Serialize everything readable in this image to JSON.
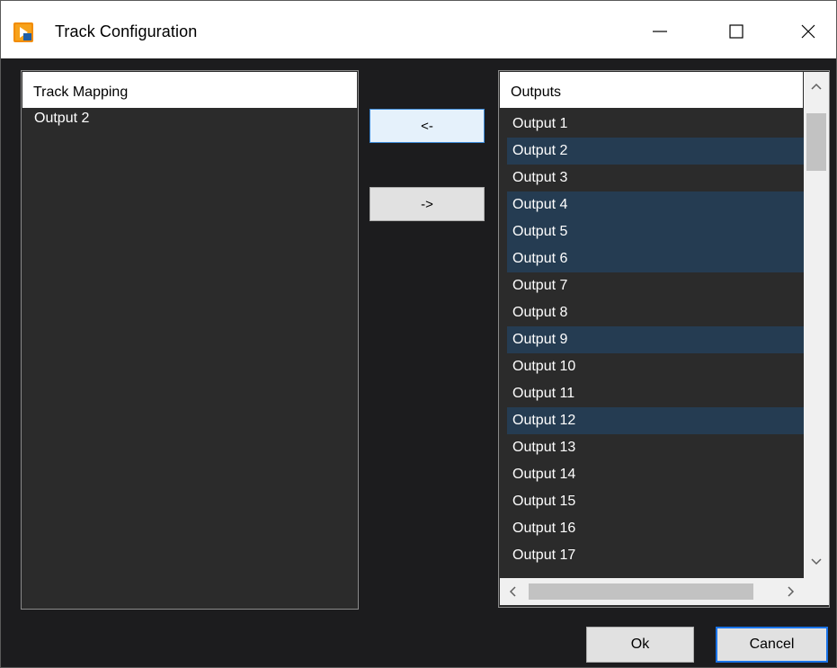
{
  "window": {
    "title": "Track Configuration",
    "icons": {
      "app": "app-icon",
      "minimize": "minimize-icon",
      "maximize": "maximize-icon",
      "close": "close-icon"
    }
  },
  "track_mapping": {
    "header": "Track Mapping",
    "items": [
      "Output 2"
    ]
  },
  "outputs": {
    "header": "Outputs",
    "items": [
      {
        "label": "Output 1",
        "selected": false
      },
      {
        "label": "Output 2",
        "selected": true
      },
      {
        "label": "Output 3",
        "selected": false
      },
      {
        "label": "Output 4",
        "selected": true
      },
      {
        "label": "Output 5",
        "selected": true
      },
      {
        "label": "Output 6",
        "selected": true
      },
      {
        "label": "Output 7",
        "selected": false
      },
      {
        "label": "Output 8",
        "selected": false
      },
      {
        "label": "Output 9",
        "selected": true
      },
      {
        "label": "Output 10",
        "selected": false
      },
      {
        "label": "Output 11",
        "selected": false
      },
      {
        "label": "Output 12",
        "selected": true
      },
      {
        "label": "Output 13",
        "selected": false
      },
      {
        "label": "Output 14",
        "selected": false
      },
      {
        "label": "Output 15",
        "selected": false
      },
      {
        "label": "Output 16",
        "selected": false
      },
      {
        "label": "Output 17",
        "selected": false
      }
    ]
  },
  "buttons": {
    "add_label": "<-",
    "remove_label": "->",
    "ok_label": "Ok",
    "cancel_label": "Cancel"
  },
  "colors": {
    "background": "#1c1c1e",
    "list_background": "#2b2b2b",
    "selection": "#253c52",
    "focus_border": "#1a73e8"
  }
}
